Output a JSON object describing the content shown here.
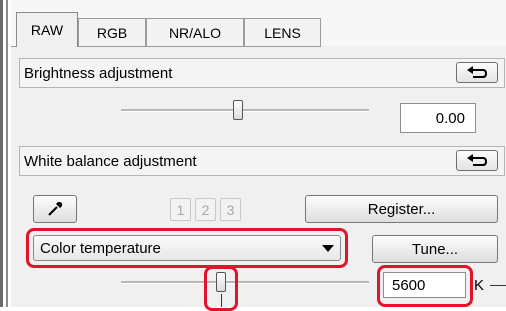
{
  "tabs": [
    {
      "label": "RAW",
      "active": true
    },
    {
      "label": "RGB",
      "active": false
    },
    {
      "label": "NR/ALO",
      "active": false
    },
    {
      "label": "LENS",
      "active": false
    }
  ],
  "brightness": {
    "title": "Brightness adjustment",
    "value": "0.00"
  },
  "white_balance": {
    "title": "White balance adjustment",
    "preset_buttons": [
      "1",
      "2",
      "3"
    ],
    "register_label": "Register...",
    "mode_selected": "Color temperature",
    "tune_label": "Tune...",
    "temperature_value": "5600",
    "temperature_unit": "K"
  },
  "colors": {
    "highlight": "#e0142b",
    "panel_bg": "#f0f0f0"
  },
  "icons": [
    "reset-arrow-icon",
    "eyedropper-icon",
    "dropdown-caret-icon"
  ]
}
